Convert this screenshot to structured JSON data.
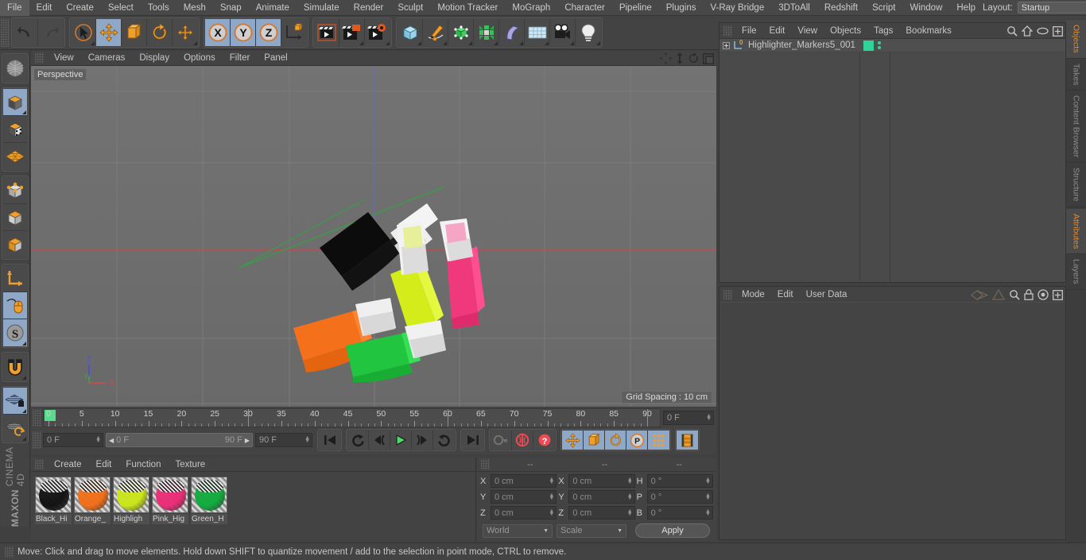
{
  "menubar": {
    "items": [
      "File",
      "Edit",
      "Create",
      "Select",
      "Tools",
      "Mesh",
      "Snap",
      "Animate",
      "Simulate",
      "Render",
      "Sculpt",
      "Motion Tracker",
      "MoGraph",
      "Character",
      "Pipeline",
      "Plugins",
      "V-Ray Bridge",
      "3DToAll",
      "Redshift",
      "Script",
      "Window",
      "Help"
    ],
    "layout_label": "Layout:",
    "layout_value": "Startup",
    "search_icon": "search-icon"
  },
  "toolbar": {
    "groups": [
      {
        "name": "history",
        "buttons": [
          {
            "name": "undo-button",
            "icon": "undo-icon",
            "active": false
          },
          {
            "name": "redo-button",
            "icon": "redo-icon",
            "active": false
          }
        ]
      },
      {
        "name": "transform",
        "buttons": [
          {
            "name": "live-selection-button",
            "icon": "cursor-select-icon",
            "active": false
          },
          {
            "name": "move-button",
            "icon": "move-arrows-icon",
            "active": true
          },
          {
            "name": "scale-button",
            "icon": "scale-box-icon",
            "active": false
          },
          {
            "name": "rotate-button",
            "icon": "rotate-circle-icon",
            "active": false
          },
          {
            "name": "magnet-move-button",
            "icon": "move-arrows-icon",
            "active": false
          }
        ]
      },
      {
        "name": "axis-locks",
        "buttons": [
          {
            "name": "lock-x-button",
            "icon": "x-axis-icon",
            "active": true
          },
          {
            "name": "lock-y-button",
            "icon": "y-axis-icon",
            "active": true
          },
          {
            "name": "lock-z-button",
            "icon": "z-axis-icon",
            "active": true
          },
          {
            "name": "world-object-coords-button",
            "icon": "world-axis-icon",
            "active": false
          }
        ]
      },
      {
        "name": "render",
        "buttons": [
          {
            "name": "render-view-button",
            "icon": "clapper-view-icon",
            "active": false
          },
          {
            "name": "render-region-button",
            "icon": "clapper-region-icon",
            "active": false
          },
          {
            "name": "render-settings-button",
            "icon": "clapper-gear-icon",
            "active": false
          }
        ]
      },
      {
        "name": "create",
        "buttons": [
          {
            "name": "add-cube-button",
            "icon": "cube-icon",
            "active": false
          },
          {
            "name": "add-spline-button",
            "icon": "pen-spline-icon",
            "active": false
          },
          {
            "name": "add-nurbs-button",
            "icon": "generator-cube-icon",
            "active": false
          },
          {
            "name": "add-array-button",
            "icon": "array-icon",
            "active": false
          },
          {
            "name": "add-deformer-button",
            "icon": "bend-deformer-icon",
            "active": false
          },
          {
            "name": "add-environment-button",
            "icon": "floor-grid-icon",
            "active": false
          },
          {
            "name": "add-camera-button",
            "icon": "camera-icon",
            "active": false
          },
          {
            "name": "add-light-button",
            "icon": "light-bulb-icon",
            "active": false
          }
        ]
      }
    ]
  },
  "lefttoolbar": {
    "groups": [
      {
        "buttons": [
          {
            "name": "make-editable-button",
            "icon": "make-editable-icon",
            "active": false
          }
        ]
      },
      {
        "buttons": [
          {
            "name": "model-mode-button",
            "icon": "model-cube-icon",
            "active": true
          },
          {
            "name": "texture-mode-button",
            "icon": "texture-cube-icon",
            "active": false
          },
          {
            "name": "uv-mode-button",
            "icon": "uv-mesh-icon",
            "active": false
          }
        ]
      },
      {
        "buttons": [
          {
            "name": "points-mode-button",
            "icon": "points-cube-icon",
            "active": false
          },
          {
            "name": "edges-mode-button",
            "icon": "edges-cube-icon",
            "active": false
          },
          {
            "name": "polygons-mode-button",
            "icon": "polygons-cube-icon",
            "active": false
          }
        ]
      },
      {
        "buttons": [
          {
            "name": "object-axis-button",
            "icon": "axis-icon",
            "active": false
          },
          {
            "name": "enable-axis-button",
            "icon": "mouse-axis-icon",
            "active": true
          },
          {
            "name": "soft-selection-button",
            "icon": "soft-selection-icon",
            "active": true
          }
        ]
      },
      {
        "buttons": [
          {
            "name": "snap-magnet-button",
            "icon": "magnet-icon",
            "active": false
          }
        ]
      },
      {
        "buttons": [
          {
            "name": "workplane-lock-button",
            "icon": "workplane-lock-icon",
            "active": true
          },
          {
            "name": "workplane-align-button",
            "icon": "workplane-rotate-icon",
            "active": false
          }
        ]
      }
    ],
    "brand_top": "MAXON",
    "brand_bottom": "CINEMA 4D"
  },
  "viewport": {
    "menu": [
      "View",
      "Cameras",
      "Display",
      "Options",
      "Filter",
      "Panel"
    ],
    "label": "Perspective",
    "grid_spacing": "Grid Spacing : 10 cm",
    "axis_gizmo": {
      "x": "X",
      "y": "Y",
      "z": "Z"
    },
    "corner_icons": [
      "pan-icon",
      "dolly-icon",
      "rotate-icon",
      "maximize-icon"
    ],
    "objects": [
      {
        "name": "black-highlighter",
        "color": "#0d0d0d"
      },
      {
        "name": "orange-highlighter",
        "color": "#f4701a"
      },
      {
        "name": "yellow-green-highlighter",
        "color": "#d5ec1b"
      },
      {
        "name": "pink-highlighter",
        "color": "#f0387c"
      },
      {
        "name": "green-highlighter",
        "color": "#21c53f"
      }
    ]
  },
  "timeline": {
    "ruler": {
      "ticks": [
        0,
        5,
        10,
        15,
        20,
        25,
        30,
        35,
        40,
        45,
        50,
        55,
        60,
        65,
        70,
        75,
        80,
        85,
        90
      ],
      "min": 0,
      "max": 90
    },
    "current_frame_right": "0 F",
    "current_frame": "0 F",
    "range_start": "0 F",
    "range_end": "90 F",
    "preview_end": "90 F",
    "transport": [
      {
        "name": "go-to-start-button",
        "icon": "skip-start-icon"
      },
      {
        "name": "previous-key-button",
        "icon": "prev-key-icon"
      },
      {
        "name": "step-back-button",
        "icon": "step-back-icon"
      },
      {
        "name": "play-button",
        "icon": "play-icon"
      },
      {
        "name": "step-forward-button",
        "icon": "step-forward-icon"
      },
      {
        "name": "next-key-button",
        "icon": "next-key-icon"
      },
      {
        "name": "go-to-end-button",
        "icon": "skip-end-icon"
      }
    ],
    "record": [
      {
        "name": "record-active-objects-button",
        "icon": "key-icon"
      },
      {
        "name": "autokeying-button",
        "icon": "autokey-icon"
      },
      {
        "name": "keyframe-selection-button",
        "icon": "keyframe-help-icon"
      }
    ],
    "keytoggles": [
      {
        "name": "position-key-button",
        "icon": "move-arrows-icon",
        "active": true
      },
      {
        "name": "scale-key-button",
        "icon": "scale-box-icon",
        "active": true
      },
      {
        "name": "rotation-key-button",
        "icon": "rotate-circle-icon",
        "active": true
      },
      {
        "name": "pla-key-button",
        "icon": "point-level-animation-icon",
        "active": true
      },
      {
        "name": "parameter-key-button",
        "icon": "param-dots-icon",
        "active": true
      }
    ],
    "filmstrip": {
      "name": "timeline-mode-button",
      "icon": "filmstrip-icon",
      "active": true
    }
  },
  "material_manager": {
    "menu": [
      "Create",
      "Edit",
      "Function",
      "Texture"
    ],
    "materials": [
      {
        "name": "Black_Hi",
        "full": "Black_Highlighter",
        "color": "#141414"
      },
      {
        "name": "Orange_",
        "full": "Orange_Highlighter",
        "color": "#f0701b"
      },
      {
        "name": "Highligh",
        "full": "Highlighter_Yellow",
        "color": "#cbe51c"
      },
      {
        "name": "Pink_Hig",
        "full": "Pink_Highlighter",
        "color": "#ea2e78"
      },
      {
        "name": "Green_H",
        "full": "Green_Highlighter",
        "color": "#14ab3f"
      }
    ]
  },
  "coordinate_manager": {
    "headers": [
      "--",
      "--",
      "--"
    ],
    "rows": [
      {
        "pos_label": "X",
        "pos_value": "0 cm",
        "size_label": "X",
        "size_value": "0 cm",
        "rot_label": "H",
        "rot_value": "0 °"
      },
      {
        "pos_label": "Y",
        "pos_value": "0 cm",
        "size_label": "Y",
        "size_value": "0 cm",
        "rot_label": "P",
        "rot_value": "0 °"
      },
      {
        "pos_label": "Z",
        "pos_value": "0 cm",
        "size_label": "Z",
        "size_value": "0 cm",
        "rot_label": "B",
        "rot_value": "0 °"
      }
    ],
    "system": "World",
    "mode": "Scale",
    "apply": "Apply"
  },
  "object_manager": {
    "menu": [
      "File",
      "Edit",
      "View",
      "Objects",
      "Tags",
      "Bookmarks"
    ],
    "icons": [
      "search-icon",
      "home-icon",
      "eye-icon",
      "add-layer-icon"
    ],
    "objects": [
      {
        "name": "Highlighter_Markers5_001",
        "layer_badge": "0",
        "tag_color": "#2fd49a"
      }
    ]
  },
  "attribute_manager": {
    "menu": [
      "Mode",
      "Edit",
      "User Data"
    ],
    "icons": [
      "interp-left-icon",
      "interp-right-icon",
      "search-icon",
      "lock-icon",
      "target-icon",
      "add-icon"
    ]
  },
  "vertical_tabs": {
    "top": [
      {
        "label": "Objects",
        "active": true
      },
      {
        "label": "Takes",
        "active": false
      },
      {
        "label": "Content Browser",
        "active": false
      },
      {
        "label": "Structure",
        "active": false
      }
    ],
    "bottom": [
      {
        "label": "Attributes",
        "active": true
      },
      {
        "label": "Layers",
        "active": false
      }
    ]
  },
  "statusbar": {
    "message": "Move: Click and drag to move elements. Hold down SHIFT to quantize movement / add to the selection in point mode, CTRL to remove."
  },
  "colors": {
    "accent_orange": "#e08a2e",
    "active_blue": "#8fa8c8",
    "panel_bg": "#434343",
    "viewport_bg": "#6d6d6d"
  }
}
